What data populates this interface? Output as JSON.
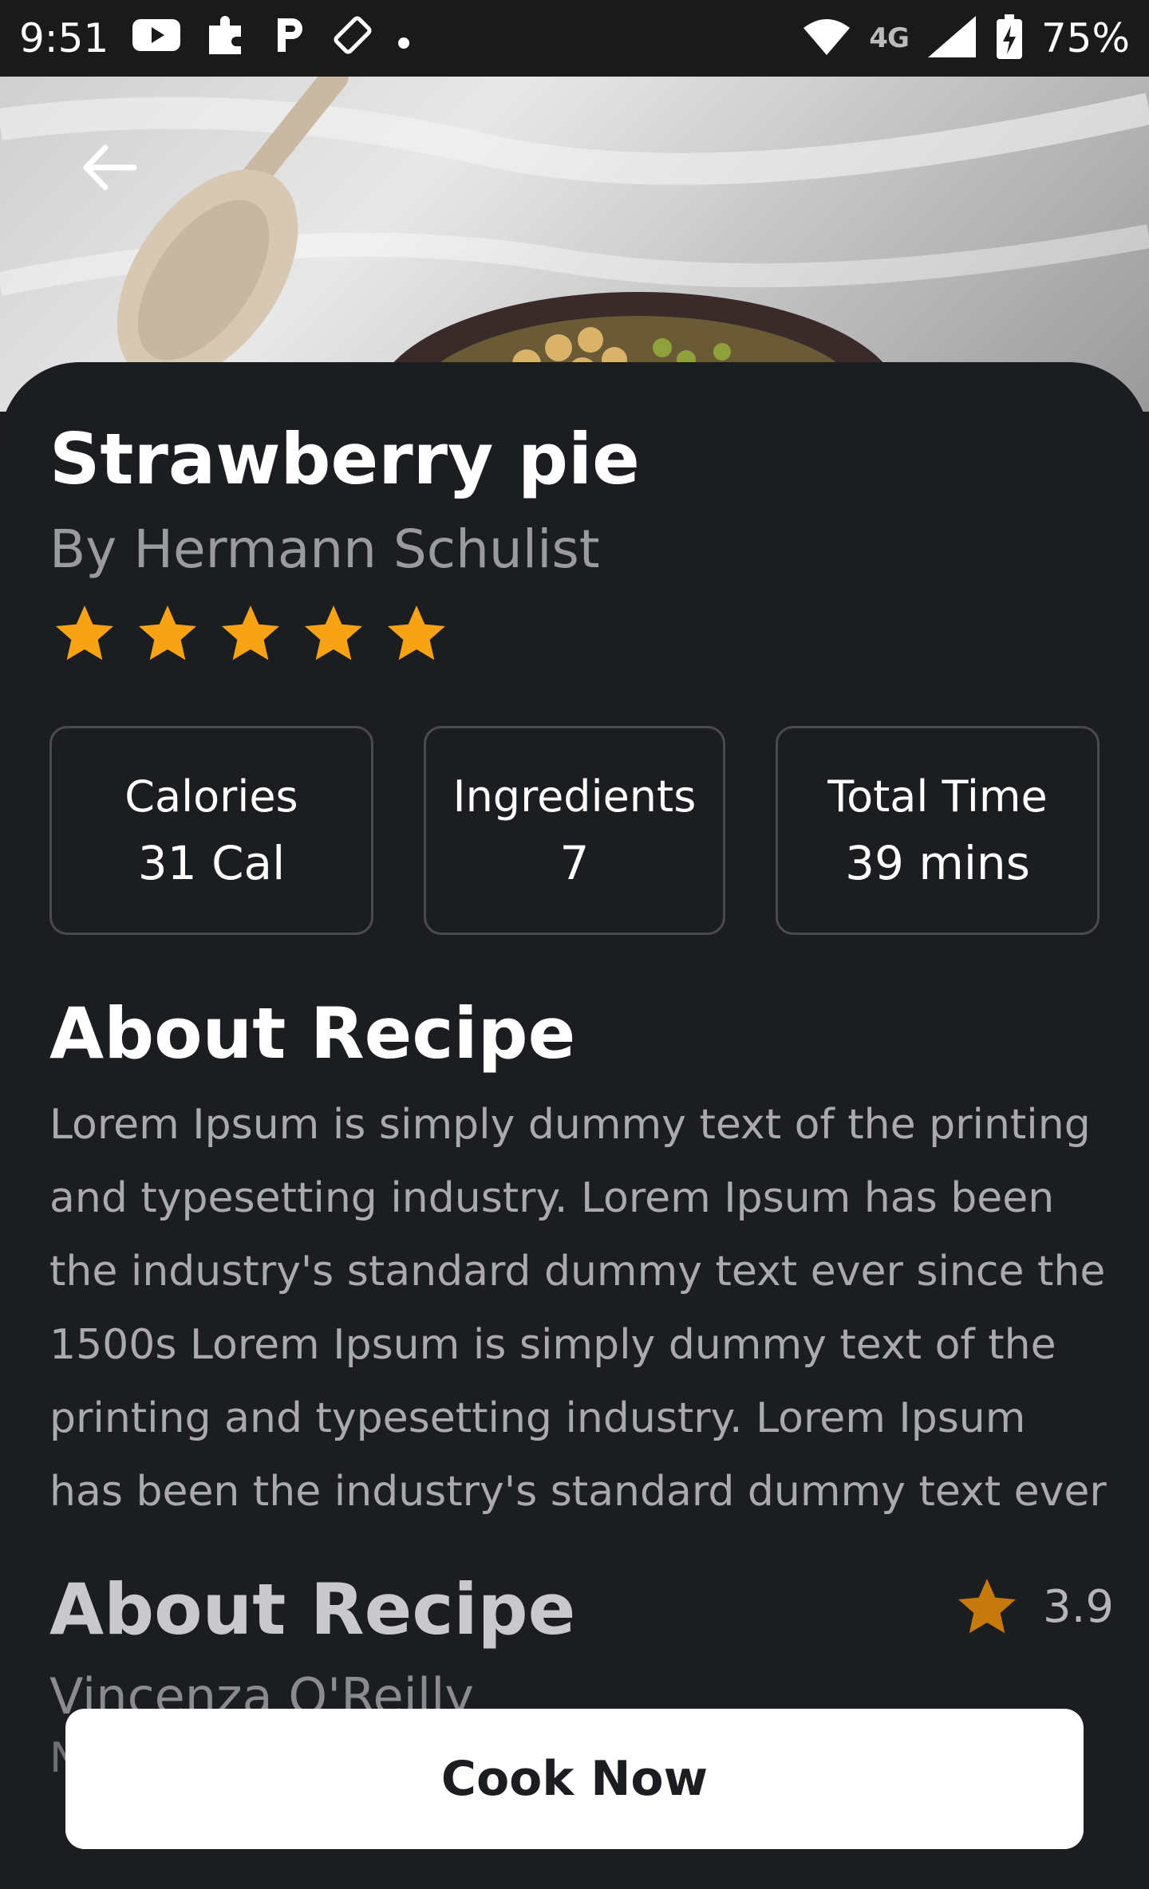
{
  "status_bar": {
    "time": "9:51",
    "network": "4G",
    "battery": "75%"
  },
  "recipe": {
    "title": "Strawberry pie",
    "author": "By Hermann Schulist",
    "rating_stars": 5
  },
  "stats": [
    {
      "label": "Calories",
      "value": "31 Cal"
    },
    {
      "label": "Ingredients",
      "value": "7"
    },
    {
      "label": "Total Time",
      "value": "39 mins"
    }
  ],
  "about": {
    "heading": "About Recipe",
    "text": "Lorem Ipsum is simply dummy text of the printing and typesetting industry. Lorem Ipsum has been the industry's standard dummy text ever since the 1500s Lorem Ipsum is simply dummy text of the printing and typesetting industry. Lorem Ipsum has been the industry's standard dummy text ever"
  },
  "review": {
    "heading": "About Recipe",
    "rating": "3.9",
    "reviewer": "Vincenza O'Reilly",
    "text": "N"
  },
  "cta": {
    "label": "Cook Now"
  },
  "colors": {
    "background": "#1c1d21",
    "star": "#f7a313",
    "rating_star": "#c77a0c",
    "button": "#ffffff"
  }
}
